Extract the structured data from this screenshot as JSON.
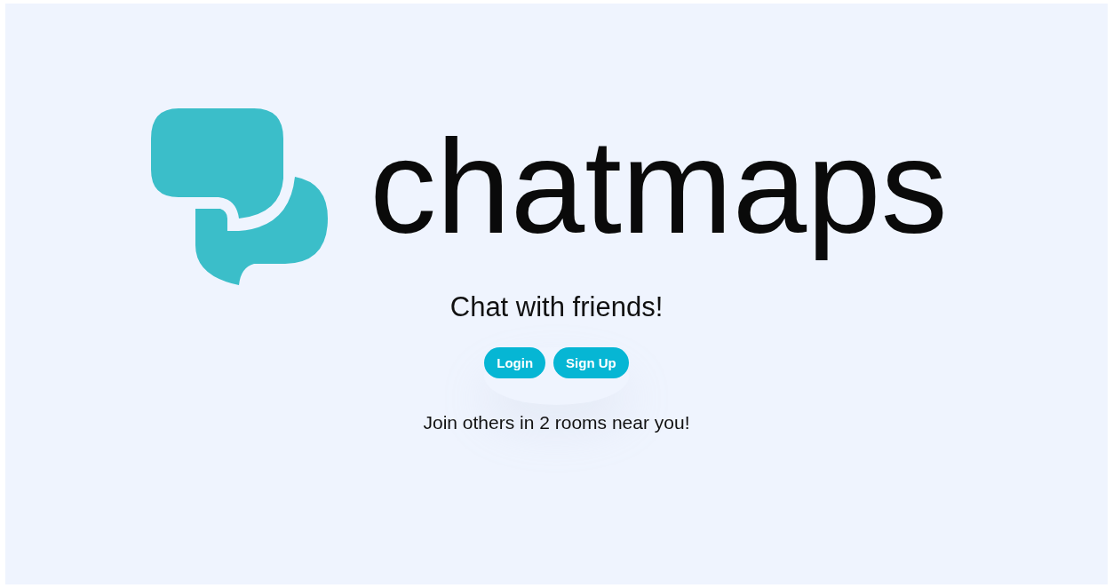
{
  "brand": {
    "name": "chatmaps"
  },
  "tagline": "Chat with friends!",
  "buttons": [
    {
      "label": "Login"
    },
    {
      "label": "Sign Up"
    }
  ],
  "footer_text": "Join others in 2 rooms near you!"
}
